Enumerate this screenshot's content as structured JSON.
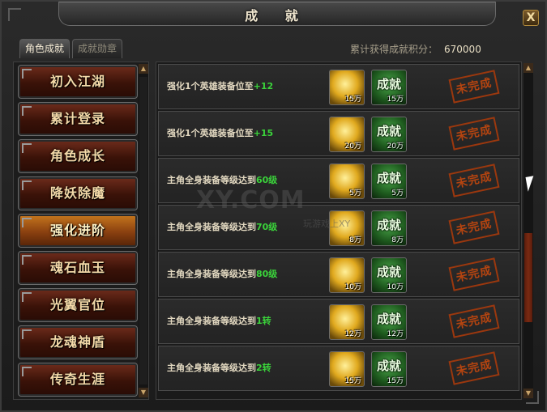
{
  "window": {
    "title": "成 就",
    "close_label": "X"
  },
  "tabs": [
    {
      "label": "角色成就",
      "active": true
    },
    {
      "label": "成就勋章",
      "active": false
    }
  ],
  "score": {
    "label": "累计获得成就积分：",
    "value": "670000"
  },
  "categories": [
    {
      "label": "初入江湖"
    },
    {
      "label": "累计登录"
    },
    {
      "label": "角色成长"
    },
    {
      "label": "降妖除魔"
    },
    {
      "label": "强化进阶",
      "active": true
    },
    {
      "label": "魂石血玉"
    },
    {
      "label": "光翼官位"
    },
    {
      "label": "龙魂神盾"
    },
    {
      "label": "传奇生涯"
    }
  ],
  "achievements": [
    {
      "prefix": "强化1个英雄装备位至",
      "highlight": "+12",
      "suffix": "",
      "gold": "15万",
      "honor_label": "成就",
      "honor": "15万",
      "status": "未完成"
    },
    {
      "prefix": "强化1个英雄装备位至",
      "highlight": "+15",
      "suffix": "",
      "gold": "20万",
      "honor_label": "成就",
      "honor": "20万",
      "status": "未完成"
    },
    {
      "prefix": "主角全身装备等级达到",
      "highlight": "60级",
      "suffix": "",
      "gold": "5万",
      "honor_label": "成就",
      "honor": "5万",
      "status": "未完成"
    },
    {
      "prefix": "主角全身装备等级达到",
      "highlight": "70级",
      "suffix": "",
      "gold": "8万",
      "honor_label": "成就",
      "honor": "8万",
      "status": "未完成"
    },
    {
      "prefix": "主角全身装备等级达到",
      "highlight": "80级",
      "suffix": "",
      "gold": "10万",
      "honor_label": "成就",
      "honor": "10万",
      "status": "未完成"
    },
    {
      "prefix": "主角全身装备等级达到",
      "highlight": "1转",
      "suffix": "",
      "gold": "12万",
      "honor_label": "成就",
      "honor": "12万",
      "status": "未完成"
    },
    {
      "prefix": "主角全身装备等级达到",
      "highlight": "2转",
      "suffix": "",
      "gold": "15万",
      "honor_label": "成就",
      "honor": "15万",
      "status": "未完成"
    }
  ],
  "watermark": {
    "text": "XY.COM",
    "sub": "玩游戏上XY"
  },
  "scroll_arrows": {
    "up": "▲",
    "down": "▼"
  },
  "colors": {
    "highlight": "#3ad23a",
    "stamp": "#c4480e",
    "active_category": "#c2731c"
  }
}
